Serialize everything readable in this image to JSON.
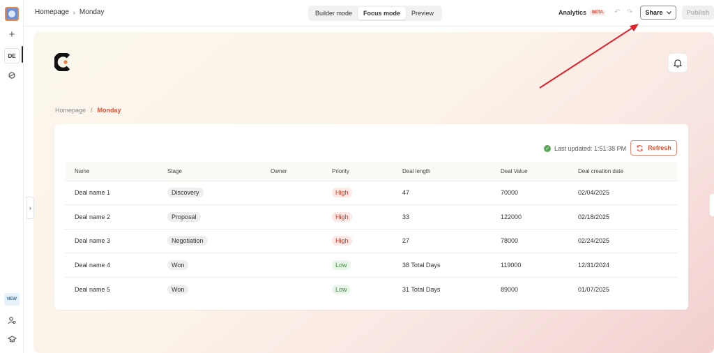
{
  "rail": {
    "workspace_badge": "DE",
    "new_badge": "NEW",
    "icons": [
      "app-logo",
      "plus-icon",
      "workspace-badge",
      "theme-icon",
      "users-settings-icon",
      "graduation-cap-icon"
    ]
  },
  "topbar": {
    "breadcrumb": [
      "Homepage",
      "Monday"
    ],
    "modes": [
      "Builder mode",
      "Focus mode",
      "Preview"
    ],
    "active_mode": "Focus mode",
    "analytics_label": "Analytics",
    "beta_label": "BETA",
    "share_label": "Share",
    "publish_label": "Publish"
  },
  "page": {
    "breadcrumb": {
      "root": "Homepage",
      "sep": "/",
      "current": "Monday"
    },
    "last_updated": "Last updated: 1:51:38 PM",
    "refresh_label": "Refresh"
  },
  "table": {
    "columns": [
      "Name",
      "Stage",
      "Owner",
      "Priority",
      "Deal length",
      "Deal Value",
      "Deal creation date"
    ],
    "rows": [
      {
        "name": "Deal name 1",
        "stage": "Discovery",
        "owner": "",
        "priority": "High",
        "length": "47",
        "value": "70000",
        "date": "02/04/2025"
      },
      {
        "name": "Deal name 2",
        "stage": "Proposal",
        "owner": "",
        "priority": "High",
        "length": "33",
        "value": "122000",
        "date": "02/18/2025"
      },
      {
        "name": "Deal name 3",
        "stage": "Negotiation",
        "owner": "",
        "priority": "High",
        "length": "27",
        "value": "78000",
        "date": "02/24/2025"
      },
      {
        "name": "Deal name 4",
        "stage": "Won",
        "owner": "",
        "priority": "Low",
        "length": "38 Total Days",
        "value": "119000",
        "date": "12/31/2024"
      },
      {
        "name": "Deal name 5",
        "stage": "Won",
        "owner": "",
        "priority": "Low",
        "length": "31 Total Days",
        "value": "89000",
        "date": "01/07/2025"
      }
    ]
  },
  "colors": {
    "accent": "#d9543b",
    "annotation_arrow": "#e0202a",
    "high_priority": "#d23d2b",
    "low_priority": "#3f8a3f"
  }
}
